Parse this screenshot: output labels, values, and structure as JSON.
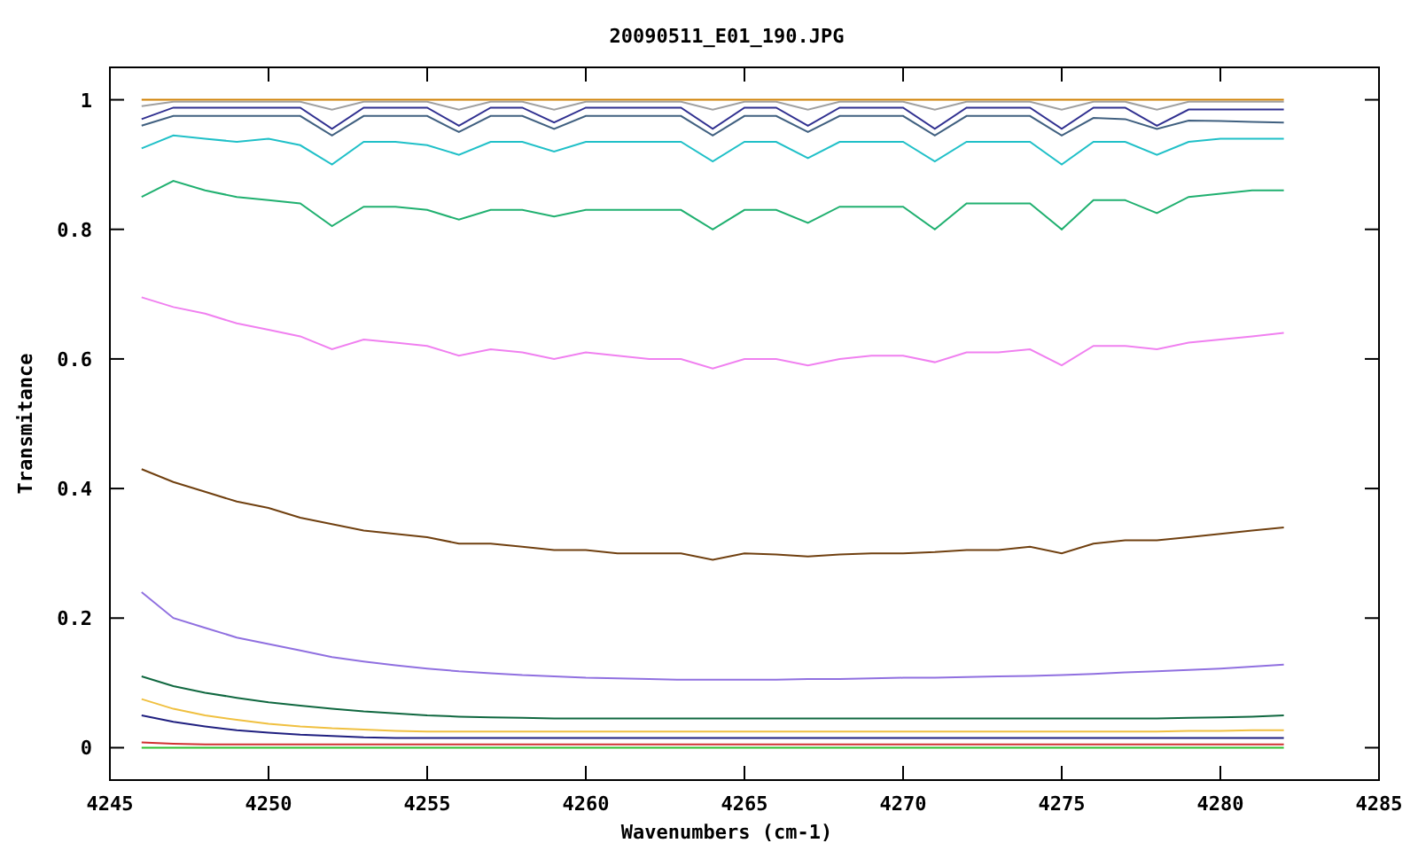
{
  "chart_data": {
    "type": "line",
    "title": "20090511_E01_190.JPG",
    "xlabel": "Wavenumbers (cm-1)",
    "ylabel": "Transmitance",
    "xlim": [
      4245,
      4285
    ],
    "ylim": [
      -0.05,
      1.05
    ],
    "xticks": [
      4245,
      4250,
      4255,
      4260,
      4265,
      4270,
      4275,
      4280,
      4285
    ],
    "yticks": [
      0,
      0.2,
      0.4,
      0.6,
      0.8,
      1
    ],
    "x": [
      4246,
      4247,
      4248,
      4249,
      4250,
      4251,
      4252,
      4253,
      4254,
      4255,
      4256,
      4257,
      4258,
      4259,
      4260,
      4261,
      4262,
      4263,
      4264,
      4265,
      4266,
      4267,
      4268,
      4269,
      4270,
      4271,
      4272,
      4273,
      4274,
      4275,
      4276,
      4277,
      4278,
      4279,
      4280,
      4281,
      4282
    ],
    "series": [
      {
        "color": "#d08000",
        "values": [
          1,
          1,
          1,
          1,
          1,
          1,
          1,
          1,
          1,
          1,
          1,
          1,
          1,
          1,
          1,
          1,
          1,
          1,
          1,
          1,
          1,
          1,
          1,
          1,
          1,
          1,
          1,
          1,
          1,
          1,
          1,
          1,
          1,
          1,
          1,
          1,
          1
        ]
      },
      {
        "color": "#a0a0a0",
        "values": [
          0.99,
          0.997,
          0.997,
          0.997,
          0.997,
          0.997,
          0.985,
          0.997,
          0.997,
          0.997,
          0.985,
          0.997,
          0.997,
          0.985,
          0.997,
          0.997,
          0.997,
          0.997,
          0.985,
          0.997,
          0.997,
          0.985,
          0.997,
          0.997,
          0.997,
          0.985,
          0.997,
          0.997,
          0.997,
          0.985,
          0.997,
          0.997,
          0.985,
          0.997,
          0.997,
          0.997,
          0.997
        ]
      },
      {
        "color": "#303090",
        "values": [
          0.97,
          0.988,
          0.988,
          0.988,
          0.988,
          0.988,
          0.955,
          0.988,
          0.988,
          0.988,
          0.96,
          0.988,
          0.988,
          0.965,
          0.988,
          0.988,
          0.988,
          0.988,
          0.955,
          0.988,
          0.988,
          0.96,
          0.988,
          0.988,
          0.988,
          0.955,
          0.988,
          0.988,
          0.988,
          0.955,
          0.988,
          0.988,
          0.96,
          0.985,
          0.985,
          0.985,
          0.985
        ]
      },
      {
        "color": "#406080",
        "values": [
          0.96,
          0.975,
          0.975,
          0.975,
          0.975,
          0.975,
          0.945,
          0.975,
          0.975,
          0.975,
          0.95,
          0.975,
          0.975,
          0.955,
          0.975,
          0.975,
          0.975,
          0.975,
          0.945,
          0.975,
          0.975,
          0.95,
          0.975,
          0.975,
          0.975,
          0.945,
          0.975,
          0.975,
          0.975,
          0.945,
          0.972,
          0.97,
          0.955,
          0.968,
          0.967,
          0.966,
          0.965
        ]
      },
      {
        "color": "#20c0c8",
        "values": [
          0.925,
          0.945,
          0.94,
          0.935,
          0.94,
          0.93,
          0.9,
          0.935,
          0.935,
          0.93,
          0.915,
          0.935,
          0.935,
          0.92,
          0.935,
          0.935,
          0.935,
          0.935,
          0.905,
          0.935,
          0.935,
          0.91,
          0.935,
          0.935,
          0.935,
          0.905,
          0.935,
          0.935,
          0.935,
          0.9,
          0.935,
          0.935,
          0.915,
          0.935,
          0.94,
          0.94,
          0.94
        ]
      },
      {
        "color": "#20b070",
        "values": [
          0.85,
          0.875,
          0.86,
          0.85,
          0.845,
          0.84,
          0.805,
          0.835,
          0.835,
          0.83,
          0.815,
          0.83,
          0.83,
          0.82,
          0.83,
          0.83,
          0.83,
          0.83,
          0.8,
          0.83,
          0.83,
          0.81,
          0.835,
          0.835,
          0.835,
          0.8,
          0.84,
          0.84,
          0.84,
          0.8,
          0.845,
          0.845,
          0.825,
          0.85,
          0.855,
          0.86,
          0.86
        ]
      },
      {
        "color": "#f080f0",
        "values": [
          0.695,
          0.68,
          0.67,
          0.655,
          0.645,
          0.635,
          0.615,
          0.63,
          0.625,
          0.62,
          0.605,
          0.615,
          0.61,
          0.6,
          0.61,
          0.605,
          0.6,
          0.6,
          0.585,
          0.6,
          0.6,
          0.59,
          0.6,
          0.605,
          0.605,
          0.595,
          0.61,
          0.61,
          0.615,
          0.59,
          0.62,
          0.62,
          0.615,
          0.625,
          0.63,
          0.635,
          0.64
        ]
      },
      {
        "color": "#704010",
        "values": [
          0.43,
          0.41,
          0.395,
          0.38,
          0.37,
          0.355,
          0.345,
          0.335,
          0.33,
          0.325,
          0.315,
          0.315,
          0.31,
          0.305,
          0.305,
          0.3,
          0.3,
          0.3,
          0.29,
          0.3,
          0.298,
          0.295,
          0.298,
          0.3,
          0.3,
          0.302,
          0.305,
          0.305,
          0.31,
          0.3,
          0.315,
          0.32,
          0.32,
          0.325,
          0.33,
          0.335,
          0.34
        ]
      },
      {
        "color": "#9070e0",
        "values": [
          0.24,
          0.2,
          0.185,
          0.17,
          0.16,
          0.15,
          0.14,
          0.133,
          0.127,
          0.122,
          0.118,
          0.115,
          0.112,
          0.11,
          0.108,
          0.107,
          0.106,
          0.105,
          0.105,
          0.105,
          0.105,
          0.106,
          0.106,
          0.107,
          0.108,
          0.108,
          0.109,
          0.11,
          0.111,
          0.112,
          0.114,
          0.116,
          0.118,
          0.12,
          0.122,
          0.125,
          0.128
        ]
      },
      {
        "color": "#106840",
        "values": [
          0.11,
          0.095,
          0.085,
          0.077,
          0.07,
          0.065,
          0.06,
          0.056,
          0.053,
          0.05,
          0.048,
          0.047,
          0.046,
          0.045,
          0.045,
          0.045,
          0.045,
          0.045,
          0.045,
          0.045,
          0.045,
          0.045,
          0.045,
          0.045,
          0.045,
          0.045,
          0.045,
          0.045,
          0.045,
          0.045,
          0.045,
          0.045,
          0.045,
          0.046,
          0.047,
          0.048,
          0.05
        ]
      },
      {
        "color": "#f0c040",
        "values": [
          0.075,
          0.06,
          0.05,
          0.043,
          0.037,
          0.033,
          0.03,
          0.028,
          0.026,
          0.025,
          0.025,
          0.025,
          0.025,
          0.025,
          0.025,
          0.025,
          0.025,
          0.025,
          0.025,
          0.025,
          0.025,
          0.025,
          0.025,
          0.025,
          0.025,
          0.025,
          0.025,
          0.025,
          0.025,
          0.025,
          0.025,
          0.025,
          0.025,
          0.026,
          0.026,
          0.027,
          0.027
        ]
      },
      {
        "color": "#202080",
        "values": [
          0.05,
          0.04,
          0.033,
          0.027,
          0.023,
          0.02,
          0.018,
          0.016,
          0.015,
          0.015,
          0.015,
          0.015,
          0.015,
          0.015,
          0.015,
          0.015,
          0.015,
          0.015,
          0.015,
          0.015,
          0.015,
          0.015,
          0.015,
          0.015,
          0.015,
          0.015,
          0.015,
          0.015,
          0.015,
          0.015,
          0.015,
          0.015,
          0.015,
          0.015,
          0.015,
          0.015,
          0.015
        ]
      },
      {
        "color": "#d03030",
        "values": [
          0.008,
          0.006,
          0.005,
          0.005,
          0.005,
          0.005,
          0.005,
          0.005,
          0.005,
          0.005,
          0.005,
          0.005,
          0.005,
          0.005,
          0.005,
          0.005,
          0.005,
          0.005,
          0.005,
          0.005,
          0.005,
          0.005,
          0.005,
          0.005,
          0.005,
          0.005,
          0.005,
          0.005,
          0.005,
          0.005,
          0.005,
          0.005,
          0.005,
          0.005,
          0.005,
          0.005,
          0.005
        ]
      },
      {
        "color": "#30c030",
        "values": [
          0,
          0,
          0,
          0,
          0,
          0,
          0,
          0,
          0,
          0,
          0,
          0,
          0,
          0,
          0,
          0,
          0,
          0,
          0,
          0,
          0,
          0,
          0,
          0,
          0,
          0,
          0,
          0,
          0,
          0,
          0,
          0,
          0,
          0,
          0,
          0,
          0
        ]
      }
    ]
  }
}
